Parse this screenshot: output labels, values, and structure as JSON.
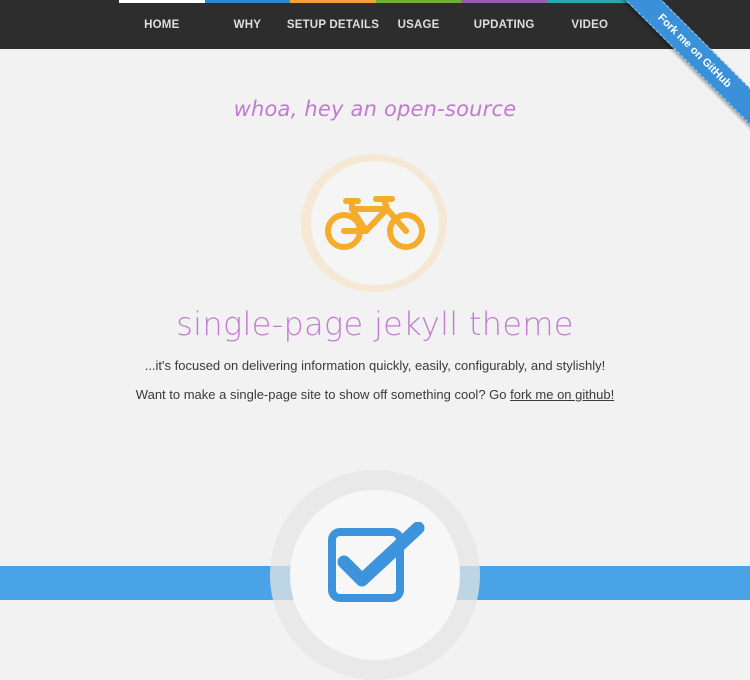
{
  "nav": {
    "items": [
      {
        "label": "HOME",
        "color": "#ffffff"
      },
      {
        "label": "WHY",
        "color": "#2f87c8"
      },
      {
        "label": "SETUP DETAILS",
        "color": "#f2a23b"
      },
      {
        "label": "USAGE",
        "color": "#6fae3a"
      },
      {
        "label": "UPDATING",
        "color": "#9b5bb0"
      },
      {
        "label": "VIDEO",
        "color": "#2aa6b2"
      }
    ]
  },
  "ribbon": {
    "label": "Fork me on GitHub",
    "color": "#3a91d9"
  },
  "hero": {
    "tagline": "whoa, hey an open-source",
    "icon": "bicycle-icon",
    "icon_color": "#f5ac2b",
    "title": "single-page jekyll theme",
    "subtitle": "...it's focused on delivering information quickly, easily, configurably, and stylishly!",
    "cta_prefix": "Want to make a single-page site to show off something cool? Go ",
    "cta_link": "fork me on github!"
  },
  "next_section": {
    "icon": "checkbox-checked-icon",
    "band_color": "#4aa3e6",
    "icon_color": "#3d93dc"
  }
}
